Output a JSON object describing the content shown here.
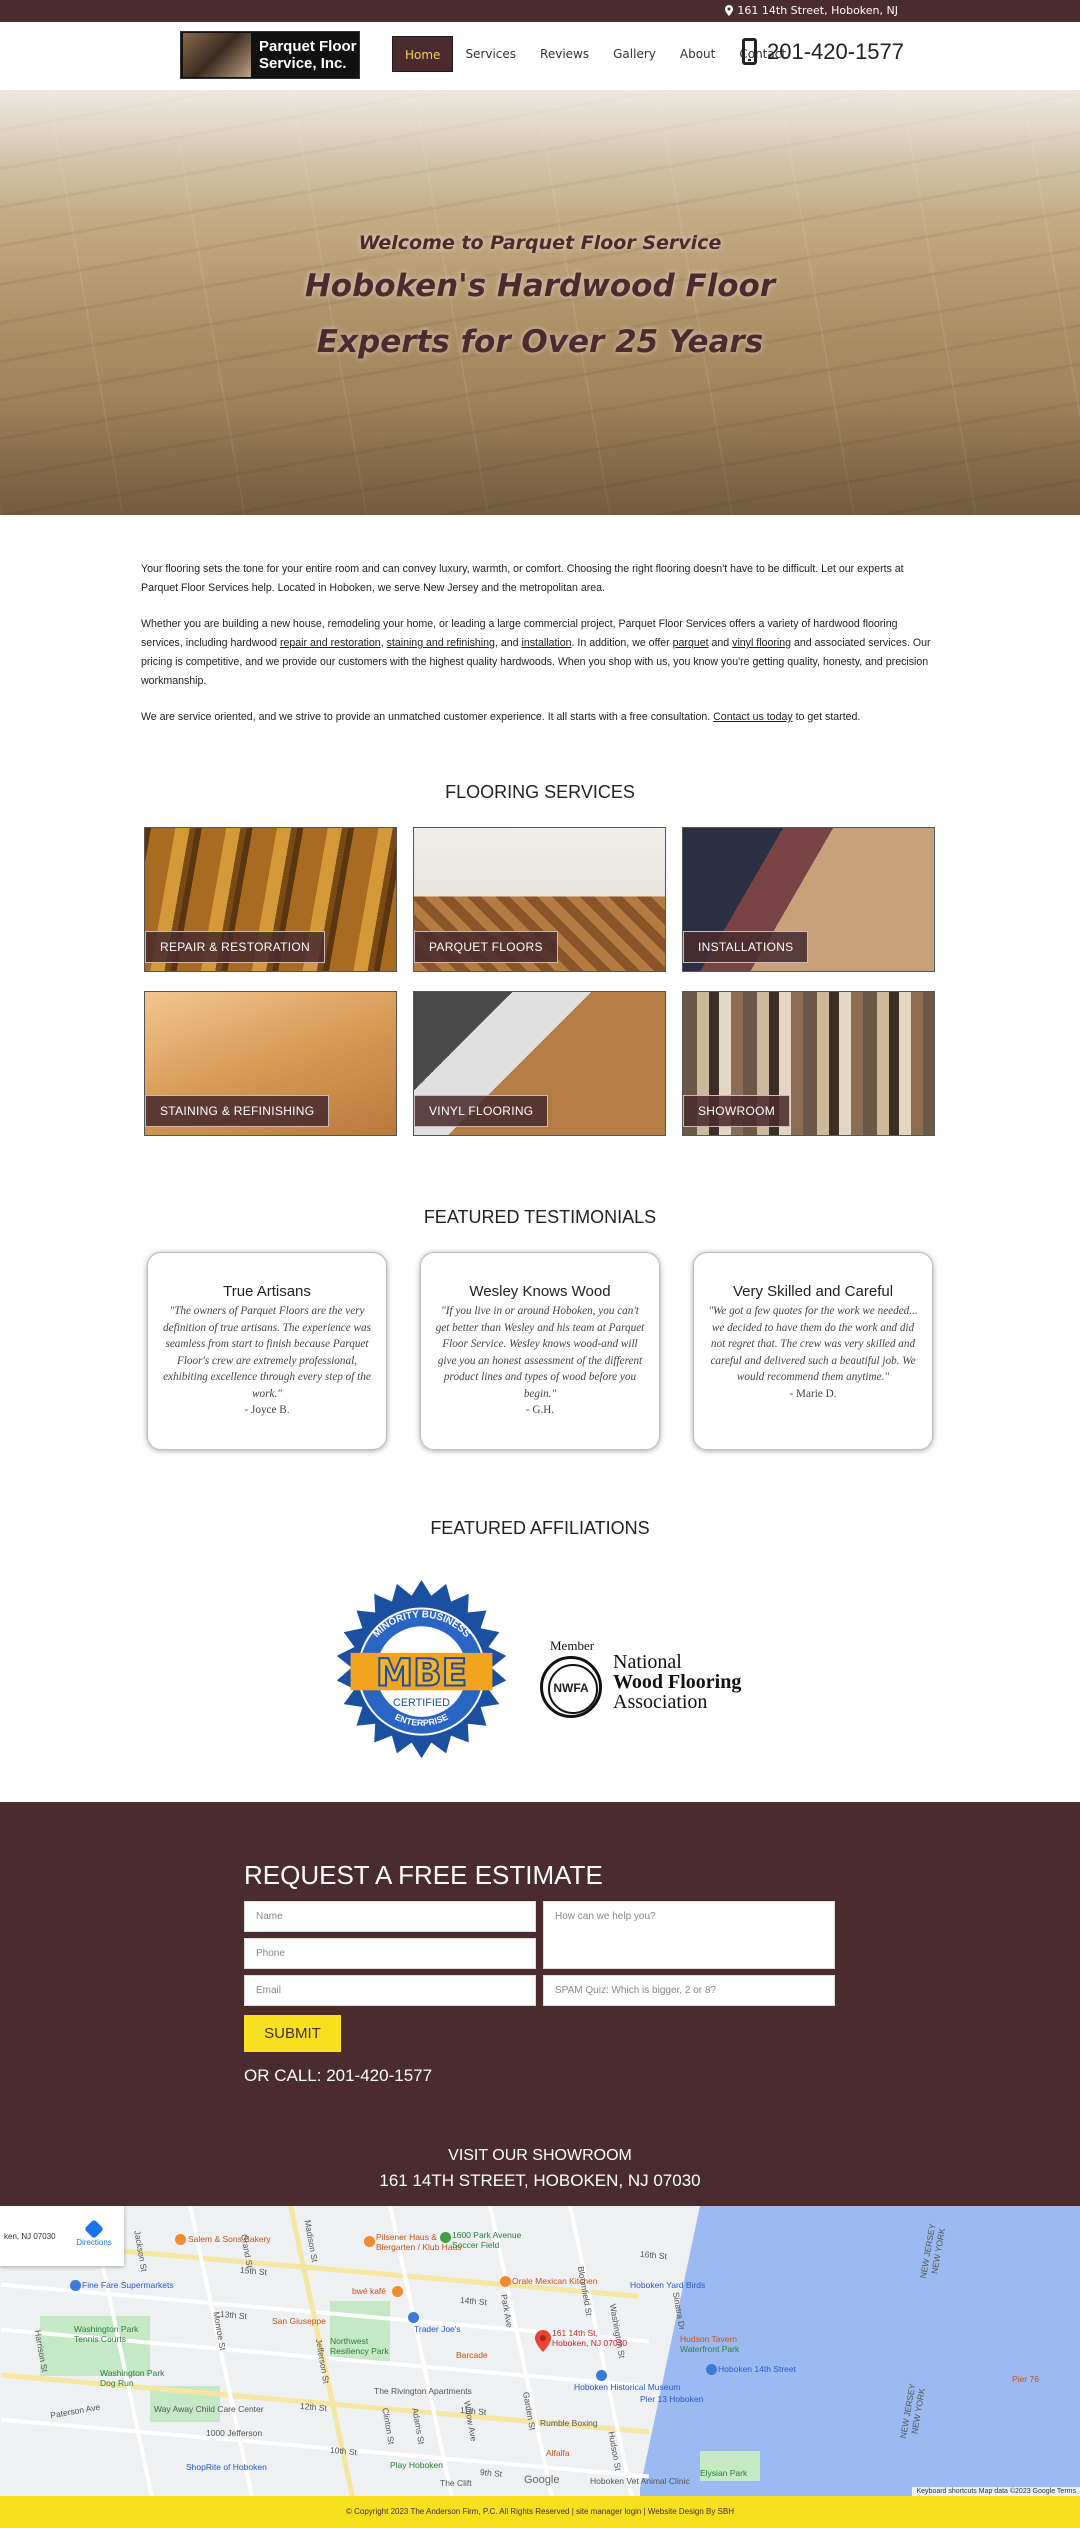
{
  "topbar": {
    "address": "161 14th Street, Hoboken, NJ"
  },
  "header": {
    "logo_text_1": "Parquet Floor",
    "logo_text_2": "Service, Inc.",
    "nav": [
      "Home",
      "Services",
      "Reviews",
      "Gallery",
      "About",
      "Contact"
    ],
    "active_nav": "Home",
    "phone": "201-420-1577"
  },
  "hero": {
    "welcome": "Welcome to Parquet Floor Service",
    "headline_1": "Hoboken's Hardwood Floor",
    "headline_2": "Experts for Over 25 Years"
  },
  "intro": {
    "p1": "Your flooring sets the tone for your entire room and can convey luxury, warmth, or comfort. Choosing the right flooring doesn't have to be difficult. Let our experts at Parquet Floor Services help. Located in Hoboken, we serve New Jersey and the metropolitan area.",
    "p2_a": "Whether you are building a new house, remodeling your home, or leading a large commercial project, Parquet Floor Services offers a variety of hardwood flooring services, including hardwood ",
    "p2_link1": "repair and restoration",
    "p2_b": ", ",
    "p2_link2": "staining and refinishing",
    "p2_c": ", and ",
    "p2_link3": "installation",
    "p2_d": ". In addition, we offer ",
    "p2_link4": "parquet",
    "p2_e": " and ",
    "p2_link5": "vinyl flooring",
    "p2_f": " and associated services. Our pricing is competitive, and we provide our customers with the highest quality hardwoods. When you shop with us, you know you're getting quality, honesty, and precision workmanship.",
    "p3_a": "We are service oriented, and we strive to provide an unmatched customer experience. It all starts with a free consultation. ",
    "p3_link": "Contact us today",
    "p3_b": " to get started."
  },
  "services": {
    "title": "FLOORING SERVICES",
    "items": [
      {
        "label": "REPAIR & RESTORATION"
      },
      {
        "label": "PARQUET FLOORS"
      },
      {
        "label": "INSTALLATIONS"
      },
      {
        "label": "STAINING & REFINISHING"
      },
      {
        "label": "VINYL FLOORING"
      },
      {
        "label": "SHOWROOM"
      }
    ]
  },
  "testimonials": {
    "title": "FEATURED TESTIMONIALS",
    "items": [
      {
        "title": "True Artisans",
        "quote": "\"The owners of Parquet Floors are the very definition of true artisans. The experience was seamless from start to finish because Parquet Floor's crew are extremely professional, exhibiting excellence through every step of the work.\"",
        "author": "- Joyce B."
      },
      {
        "title": "Wesley Knows Wood",
        "quote": "\"If you live in or around Hoboken, you can't get better than Wesley and his team at Parquet Floor Service. Wesley knows wood-and will give you an honest assessment of the different product lines and types of wood before you begin.\"",
        "author": "- G.H."
      },
      {
        "title": "Very Skilled and Careful",
        "quote": "\"We got a few quotes for the work we needed... we decided to have them do the work and did not regret that. The crew was very skilled and careful and delivered such a beautiful job. We would recommend them anytime.\"",
        "author": "- Marie D."
      }
    ]
  },
  "affiliations": {
    "title": "FEATURED AFFILIATIONS",
    "mbe": {
      "top": "MINORITY BUSINESS",
      "big": "MBE",
      "mid": "CERTIFIED",
      "bottom": "ENTERPRISE"
    },
    "nwfa": {
      "member": "Member",
      "seal": "NWFA",
      "line1": "National",
      "line2": "Wood Flooring",
      "line3": "Association"
    }
  },
  "estimate": {
    "title": "REQUEST A FREE ESTIMATE",
    "name_placeholder": "Name",
    "phone_placeholder": "Phone",
    "email_placeholder": "Email",
    "message_placeholder": "How can we help you?",
    "spam_placeholder": "SPAM Quiz: Which is bigger, 2 or 8?",
    "submit": "SUBMIT",
    "call": "OR CALL: 201-420-1577"
  },
  "showroom": {
    "title": "VISIT OUR SHOWROOM",
    "address": "161 14TH STREET, HOBOKEN, NJ 07030"
  },
  "map": {
    "card_address": "ken, NJ 07030",
    "directions": "Directions",
    "marker_label_1": "161 14th St,",
    "marker_label_2": "Hoboken, NJ 07030",
    "places": {
      "salem": "Salem & Sons Bakery",
      "pilsener": "Pilsener Haus &",
      "pilsener2": "Biergarten / Klub Haus",
      "park1600": "1600 Park Avenue",
      "park1600b": "Soccer Field",
      "orale": "Orale Mexican Kitchen",
      "yardbirds": "Hoboken Yard Birds",
      "supermarkets": "Fine Fare Supermarkets",
      "wekafe": "bwé kafé",
      "traderjoes": "Trader Joe's",
      "sanguiseppe": "San Giuseppe",
      "northwest": "Northwest",
      "resiliency": "Resiliency Park",
      "barcade": "Barcade",
      "hudsontavern": "Hudson Tavern",
      "waterfront": "Waterfront Park",
      "washingtonpark": "Washington Park",
      "tennis": "Tennis Courts",
      "washingtonpark2": "Washington Park",
      "dogrun": "Dog Run",
      "historical": "Hoboken Historical Museum",
      "pier13": "Pier 13 Hoboken",
      "hoboken14": "Hoboken 14th Street",
      "rivington": "The Rivington Apartments",
      "wayaway": "Way Away Child Care Center",
      "jefferson": "1000 Jefferson",
      "rumble": "Rumble Boxing",
      "shoprite": "ShopRite of Hoboken",
      "playhoboken": "Play Hoboken",
      "alfalfa": "Alfalfa",
      "theclift": "The Clift",
      "elysian": "Elysian Park",
      "vet": "Hoboken Vet Animal Clinic",
      "newjersey": "NEW JERSEY",
      "newyork": "NEW YORK",
      "newjersey2": "NEW JERSEY",
      "newyork2": "NEW YORK",
      "pier76": "Pier 76",
      "streets": {
        "madison": "Madison St",
        "monroe": "Monroe St",
        "jefferson": "Jefferson St",
        "adams": "Adams St",
        "grand": "Grand St",
        "clinton": "Clinton St",
        "willow": "Willow Ave",
        "park": "Park Ave",
        "garden": "Garden St",
        "bloomfield": "Bloomfield St",
        "hudson": "Hudson St",
        "washington": "Washington St",
        "sinatra": "Sinatra Dr",
        "harrison": "Harrison St",
        "paterson": "Paterson Ave",
        "jackson": "Jackson St",
        "st14": "14th St",
        "st15": "15th St",
        "st13": "13th St",
        "st12": "12th St",
        "st11": "11th St",
        "st10": "10th St",
        "st9": "9th St",
        "st16": "16th St"
      }
    },
    "attribution": "Keyboard shortcuts   Map data ©2023 Google   Terms",
    "google": "Google"
  },
  "footer": {
    "text": "© Copyright 2023 The Anderson Firm, P.C. All Rights Reserved | site manager login | Website Design By SBH"
  },
  "colors": {
    "brand": "#4a2c2e",
    "accent": "#f7e11e",
    "nav_active_text": "#f0d54a"
  }
}
